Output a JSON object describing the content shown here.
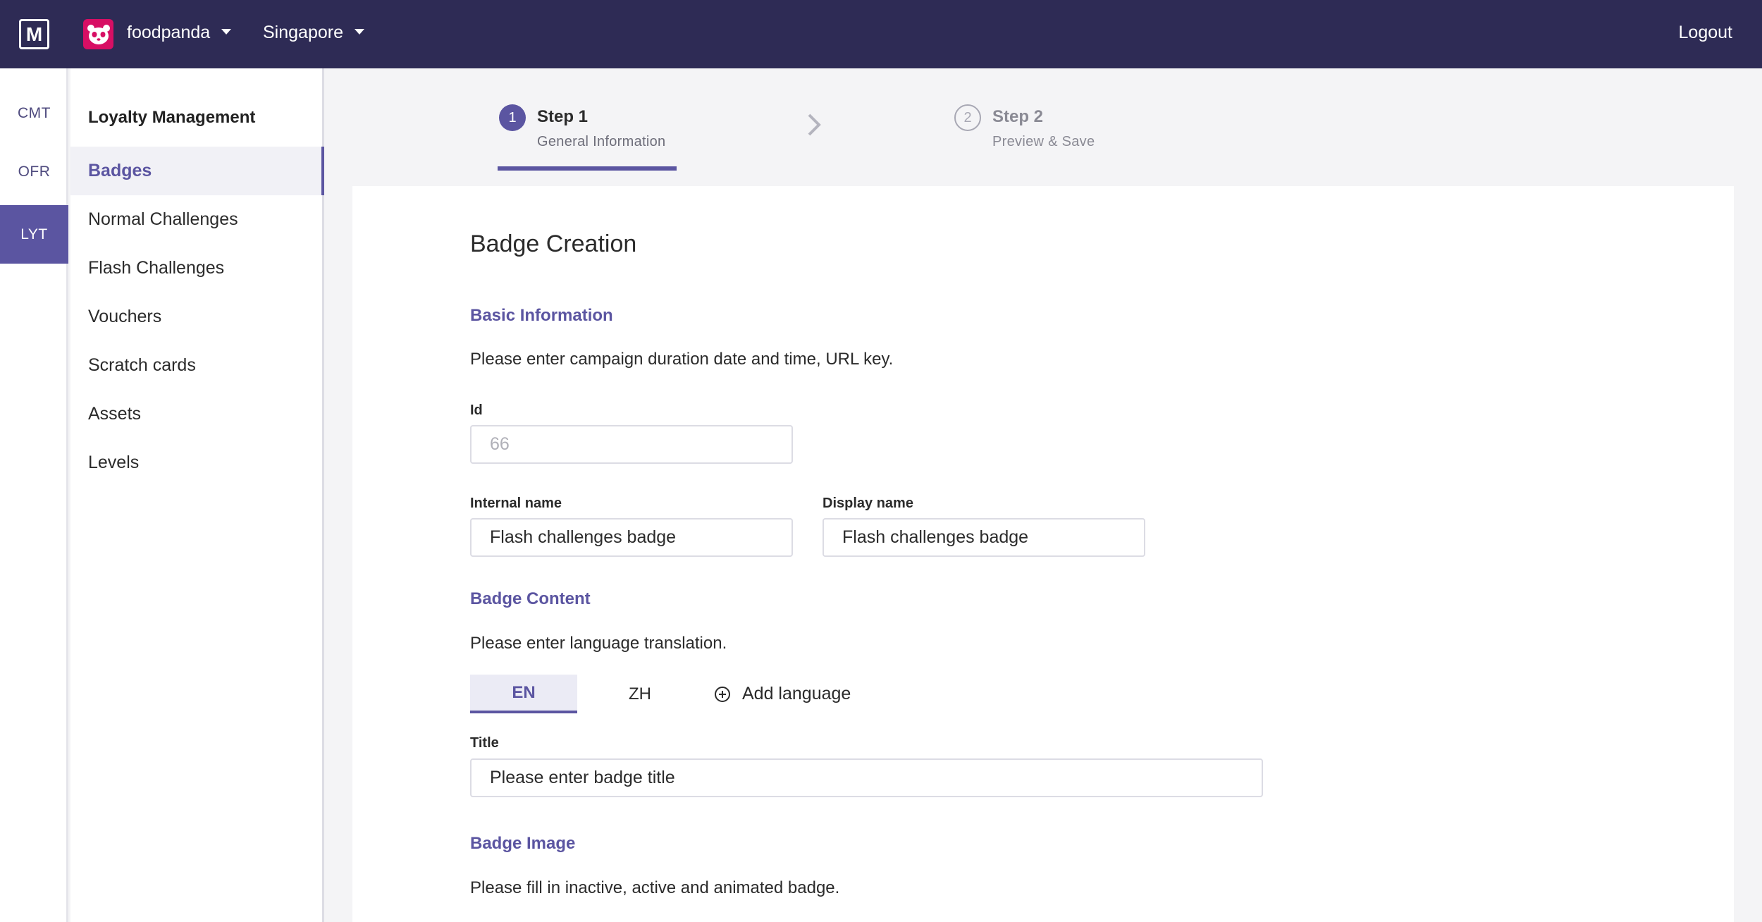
{
  "topbar": {
    "logo_text": "M",
    "brand_icon": "panda-icon",
    "brand_label": "foodpanda",
    "country_label": "Singapore",
    "logout_label": "Logout"
  },
  "rail": {
    "items": [
      {
        "label": "CMT",
        "active": false
      },
      {
        "label": "OFR",
        "active": false
      },
      {
        "label": "LYT",
        "active": true
      }
    ]
  },
  "sidebar": {
    "title": "Loyalty Management",
    "items": [
      {
        "label": "Badges",
        "active": true
      },
      {
        "label": "Normal Challenges",
        "active": false
      },
      {
        "label": "Flash Challenges",
        "active": false
      },
      {
        "label": "Vouchers",
        "active": false
      },
      {
        "label": "Scratch cards",
        "active": false
      },
      {
        "label": "Assets",
        "active": false
      },
      {
        "label": "Levels",
        "active": false
      }
    ]
  },
  "stepper": {
    "steps": [
      {
        "number": "1",
        "title": "Step 1",
        "subtitle": "General Information",
        "active": true
      },
      {
        "number": "2",
        "title": "Step 2",
        "subtitle": "Preview & Save",
        "active": false
      }
    ]
  },
  "form": {
    "title": "Badge Creation",
    "basic_info": {
      "heading": "Basic Information",
      "description": "Please enter campaign duration date and time, URL key.",
      "id_label": "Id",
      "id_value": "66",
      "internal_name_label": "Internal name",
      "internal_name_value": "Flash challenges badge",
      "display_name_label": "Display name",
      "display_name_value": "Flash challenges badge"
    },
    "badge_content": {
      "heading": "Badge Content",
      "description": "Please enter language translation.",
      "languages": [
        {
          "label": "EN",
          "active": true
        },
        {
          "label": "ZH",
          "active": false
        }
      ],
      "add_language_label": "Add language",
      "title_label": "Title",
      "title_placeholder": "Please enter badge title"
    },
    "badge_image": {
      "heading": "Badge Image",
      "description": "Please fill in inactive, active and animated badge."
    }
  },
  "colors": {
    "topbar_bg": "#2e2b55",
    "accent": "#5b55a1",
    "brand": "#d70f64"
  }
}
